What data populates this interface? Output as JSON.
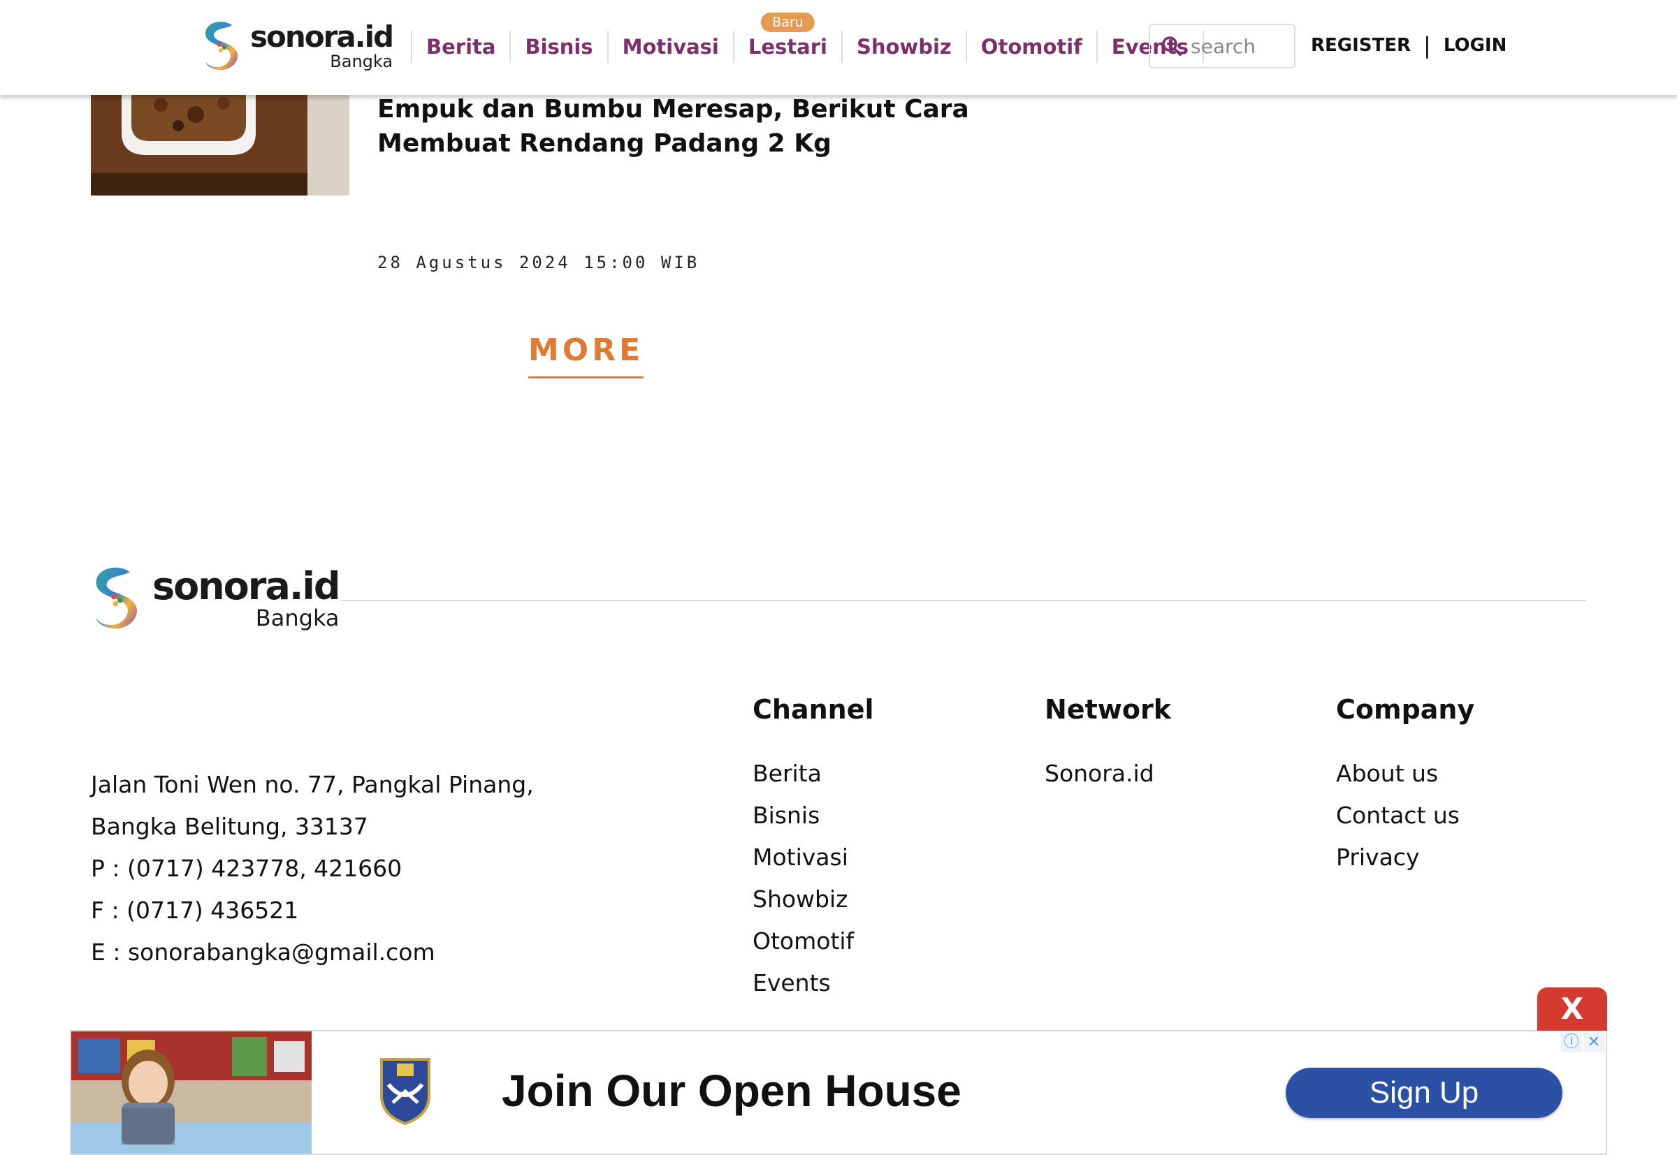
{
  "header": {
    "logo": {
      "brand": "sonora.id",
      "sub": "Bangka"
    },
    "nav": [
      {
        "label": "Berita"
      },
      {
        "label": "Bisnis"
      },
      {
        "label": "Motivasi"
      },
      {
        "label": "Lestari",
        "badge": "Baru"
      },
      {
        "label": "Showbiz"
      },
      {
        "label": "Otomotif"
      },
      {
        "label": "Events"
      }
    ],
    "search_placeholder": "search",
    "register": "REGISTER",
    "separator": "|",
    "login": "LOGIN"
  },
  "article": {
    "title": "Empuk dan Bumbu Meresap, Berikut Cara Membuat Rendang Padang 2 Kg",
    "date": "28 Agustus 2024 15:00 WIB"
  },
  "more_label": "MORE",
  "footer": {
    "logo": {
      "brand": "sonora.id",
      "sub": "Bangka"
    },
    "address_lines": [
      "Jalan Toni Wen no. 77, Pangkal Pinang,",
      "Bangka Belitung, 33137",
      "P : (0717) 423778, 421660",
      "F : (0717) 436521",
      "E : sonorabangka@gmail.com"
    ],
    "channel": {
      "title": "Channel",
      "items": [
        "Berita",
        "Bisnis",
        "Motivasi",
        "Showbiz",
        "Otomotif",
        "Events"
      ]
    },
    "network": {
      "title": "Network",
      "items": [
        "Sonora.id"
      ]
    },
    "company": {
      "title": "Company",
      "items": [
        "About us",
        "Contact us",
        "Privacy"
      ]
    }
  },
  "ad": {
    "close_label": "X",
    "headline": "Join Our Open House",
    "cta": "Sign Up",
    "cta_color": "#2b51a4",
    "close_color": "#d43a2f"
  },
  "colors": {
    "nav": "#7b2f6b",
    "accent": "#e07b35",
    "badge": "#e59b52"
  }
}
